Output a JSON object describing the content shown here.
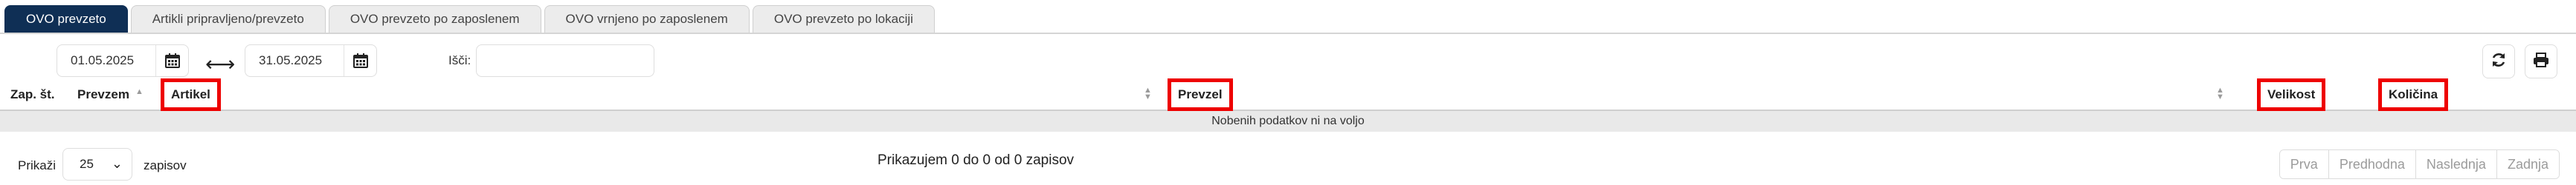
{
  "tabs": [
    {
      "label": "OVO prevzeto",
      "active": true
    },
    {
      "label": "Artikli pripravljeno/prevzeto",
      "active": false
    },
    {
      "label": "OVO prevzeto po zaposlenem",
      "active": false
    },
    {
      "label": "OVO vrnjeno po zaposlenem",
      "active": false
    },
    {
      "label": "OVO prevzeto po lokaciji",
      "active": false
    }
  ],
  "filters": {
    "date_from": "01.05.2025",
    "date_to": "31.05.2025",
    "range_arrow": "⟷",
    "search_label": "Išči:",
    "search_value": ""
  },
  "table": {
    "columns": [
      "Zap. št.",
      "Prevzem",
      "Artikel",
      "Prevzel",
      "Velikost",
      "Količina"
    ],
    "empty_message": "Nobenih podatkov ni na voljo"
  },
  "footer": {
    "show_label": "Prikaži",
    "page_size": "25",
    "records_label": "zapisov",
    "info": "Prikazujem 0 do 0 od 0 zapisov",
    "pager": [
      "Prva",
      "Predhodna",
      "Naslednja",
      "Zadnja"
    ]
  },
  "icons": {
    "calendar": "calendar-icon",
    "refresh": "refresh-icon",
    "print": "print-icon"
  },
  "colors": {
    "active_tab": "#0f2f55",
    "highlight": "#ee0000",
    "empty_row_bg": "#e9e9e9"
  }
}
